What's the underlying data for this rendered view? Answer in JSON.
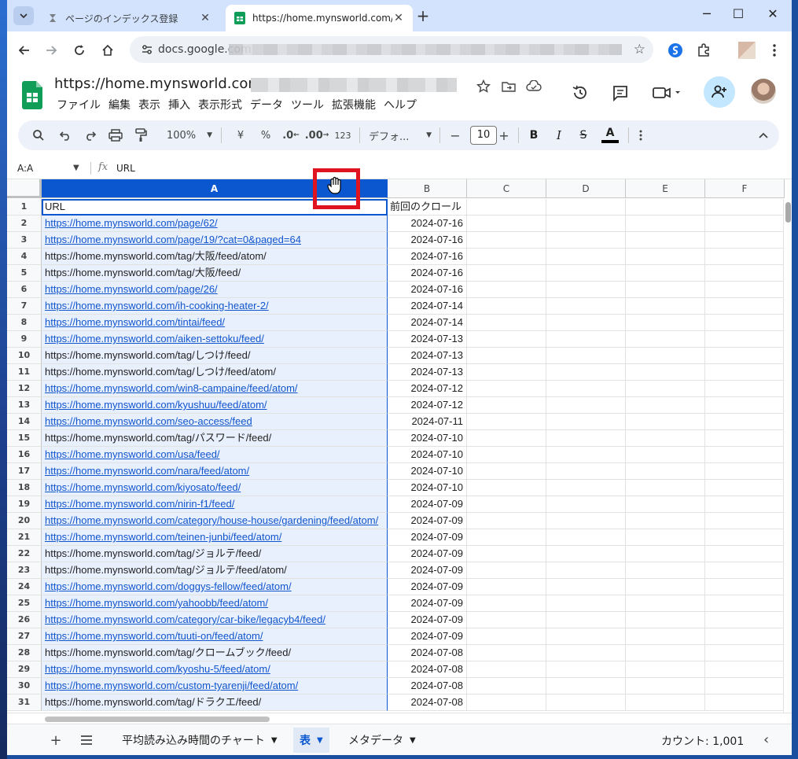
{
  "browser": {
    "tabs": [
      {
        "label": "ページのインデックス登録",
        "active": false
      },
      {
        "label": "https://home.mynsworld.com/-",
        "active": true
      }
    ],
    "address": "docs.google.com"
  },
  "doc": {
    "title": "https://home.mynsworld.com/",
    "menu": [
      "ファイル",
      "編集",
      "表示",
      "挿入",
      "表示形式",
      "データ",
      "ツール",
      "拡張機能",
      "ヘルプ"
    ]
  },
  "toolbar": {
    "zoom": "100%",
    "currency": "¥",
    "percent": "%",
    "dec_decrease": ".0",
    "dec_increase": ".00",
    "number_format": "123",
    "font": "デフォ...",
    "font_size": "10",
    "bold": "B",
    "italic": "I",
    "strike": "S",
    "text_color": "A"
  },
  "formula_bar": {
    "name_box": "A:A",
    "fx": "fx",
    "value": "URL"
  },
  "columns": [
    "A",
    "B",
    "C",
    "D",
    "E",
    "F"
  ],
  "rows": [
    {
      "n": "1",
      "url": "URL",
      "date": "前回のクロール",
      "link": false
    },
    {
      "n": "2",
      "url": "https://home.mynsworld.com/page/62/",
      "date": "2024-07-16",
      "link": true
    },
    {
      "n": "3",
      "url": "https://home.mynsworld.com/page/19/?cat=0&paged=64",
      "date": "2024-07-16",
      "link": true
    },
    {
      "n": "4",
      "url": "https://home.mynsworld.com/tag/大阪/feed/atom/",
      "date": "2024-07-16",
      "link": false
    },
    {
      "n": "5",
      "url": "https://home.mynsworld.com/tag/大阪/feed/",
      "date": "2024-07-16",
      "link": false
    },
    {
      "n": "6",
      "url": "https://home.mynsworld.com/page/26/",
      "date": "2024-07-16",
      "link": true
    },
    {
      "n": "7",
      "url": "https://home.mynsworld.com/ih-cooking-heater-2/",
      "date": "2024-07-14",
      "link": true
    },
    {
      "n": "8",
      "url": "https://home.mynsworld.com/tintai/feed/",
      "date": "2024-07-14",
      "link": true
    },
    {
      "n": "9",
      "url": "https://home.mynsworld.com/aiken-settoku/feed/",
      "date": "2024-07-13",
      "link": true
    },
    {
      "n": "10",
      "url": "https://home.mynsworld.com/tag/しつけ/feed/",
      "date": "2024-07-13",
      "link": false
    },
    {
      "n": "11",
      "url": "https://home.mynsworld.com/tag/しつけ/feed/atom/",
      "date": "2024-07-13",
      "link": false
    },
    {
      "n": "12",
      "url": "https://home.mynsworld.com/win8-campaine/feed/atom/",
      "date": "2024-07-12",
      "link": true
    },
    {
      "n": "13",
      "url": "https://home.mynsworld.com/kyushuu/feed/atom/",
      "date": "2024-07-12",
      "link": true
    },
    {
      "n": "14",
      "url": "https://home.mynsworld.com/seo-access/feed",
      "date": "2024-07-11",
      "link": true
    },
    {
      "n": "15",
      "url": "https://home.mynsworld.com/tag/パスワード/feed/",
      "date": "2024-07-10",
      "link": false
    },
    {
      "n": "16",
      "url": "https://home.mynsworld.com/usa/feed/",
      "date": "2024-07-10",
      "link": true
    },
    {
      "n": "17",
      "url": "https://home.mynsworld.com/nara/feed/atom/",
      "date": "2024-07-10",
      "link": true
    },
    {
      "n": "18",
      "url": "https://home.mynsworld.com/kiyosato/feed/",
      "date": "2024-07-10",
      "link": true
    },
    {
      "n": "19",
      "url": "https://home.mynsworld.com/nirin-f1/feed/",
      "date": "2024-07-09",
      "link": true
    },
    {
      "n": "20",
      "url": "https://home.mynsworld.com/category/house-house/gardening/feed/atom/",
      "date": "2024-07-09",
      "link": true
    },
    {
      "n": "21",
      "url": "https://home.mynsworld.com/teinen-junbi/feed/atom/",
      "date": "2024-07-09",
      "link": true
    },
    {
      "n": "22",
      "url": "https://home.mynsworld.com/tag/ジョルテ/feed/",
      "date": "2024-07-09",
      "link": false
    },
    {
      "n": "23",
      "url": "https://home.mynsworld.com/tag/ジョルテ/feed/atom/",
      "date": "2024-07-09",
      "link": false
    },
    {
      "n": "24",
      "url": "https://home.mynsworld.com/doggys-fellow/feed/atom/",
      "date": "2024-07-09",
      "link": true
    },
    {
      "n": "25",
      "url": "https://home.mynsworld.com/yahoobb/feed/atom/",
      "date": "2024-07-09",
      "link": true
    },
    {
      "n": "26",
      "url": "https://home.mynsworld.com/category/car-bike/legacyb4/feed/",
      "date": "2024-07-09",
      "link": true
    },
    {
      "n": "27",
      "url": "https://home.mynsworld.com/tuuti-on/feed/atom/",
      "date": "2024-07-09",
      "link": true
    },
    {
      "n": "28",
      "url": "https://home.mynsworld.com/tag/クロームブック/feed/",
      "date": "2024-07-08",
      "link": false
    },
    {
      "n": "29",
      "url": "https://home.mynsworld.com/kyoshu-5/feed/atom/",
      "date": "2024-07-08",
      "link": true
    },
    {
      "n": "30",
      "url": "https://home.mynsworld.com/custom-tyarenji/feed/atom/",
      "date": "2024-07-08",
      "link": true
    },
    {
      "n": "31",
      "url": "https://home.mynsworld.com/tag/ドラクエ/feed/",
      "date": "2024-07-08",
      "link": false
    }
  ],
  "sheets": [
    {
      "label": "平均読み込み時間のチャート",
      "active": false
    },
    {
      "label": "表",
      "active": true
    },
    {
      "label": "メタデータ",
      "active": false
    }
  ],
  "status": {
    "count": "カウント: 1,001"
  },
  "colors": {
    "accent": "#0b57d0",
    "link": "#1155cc",
    "highlight": "#e0141e",
    "sheets_green": "#0f9d58"
  }
}
